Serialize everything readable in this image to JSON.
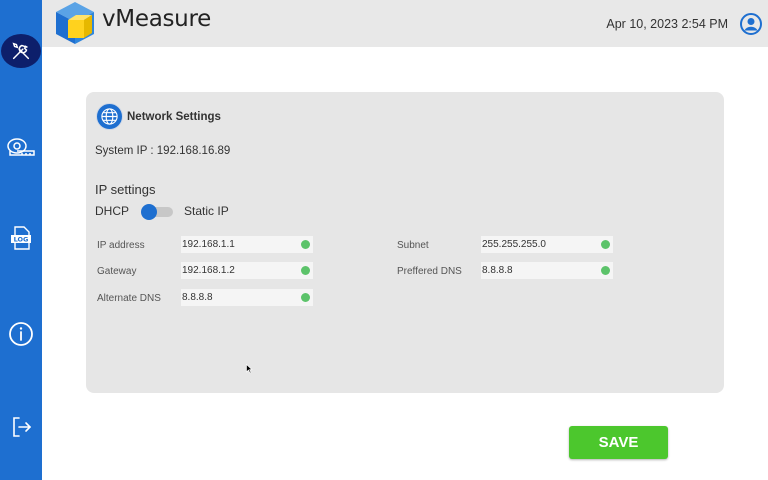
{
  "app": {
    "brand": "vMeasure"
  },
  "header": {
    "datetime": "Apr 10, 2023 2:54 PM"
  },
  "sidebar": {
    "items": [
      {
        "icon": "tools-icon",
        "active": true
      },
      {
        "icon": "measuring-tape-icon",
        "active": false
      },
      {
        "icon": "log-icon",
        "badge": "LOG",
        "active": false
      },
      {
        "icon": "info-icon",
        "active": false
      },
      {
        "icon": "logout-icon",
        "active": false
      }
    ]
  },
  "network": {
    "title": "Network Settings",
    "system_ip": "System IP : 192.168.16.89",
    "ip_settings_label": "IP settings",
    "dhcp_label": "DHCP",
    "static_label": "Static IP",
    "fields": {
      "ip_address": {
        "label": "IP address",
        "value": "192.168.1.1"
      },
      "gateway": {
        "label": "Gateway",
        "value": "192.168.1.2"
      },
      "alternate_dns": {
        "label": "Alternate DNS",
        "value": "8.8.8.8"
      },
      "subnet": {
        "label": "Subnet",
        "value": "255.255.255.0"
      },
      "preferred_dns": {
        "label": "Preffered DNS",
        "value": "8.8.8.8"
      }
    }
  },
  "actions": {
    "save_label": "SAVE"
  },
  "colors": {
    "sidebar": "#1e6fd0",
    "active_tab": "#0d1f6b",
    "save": "#4cc72d",
    "valid": "#5cc36a"
  }
}
